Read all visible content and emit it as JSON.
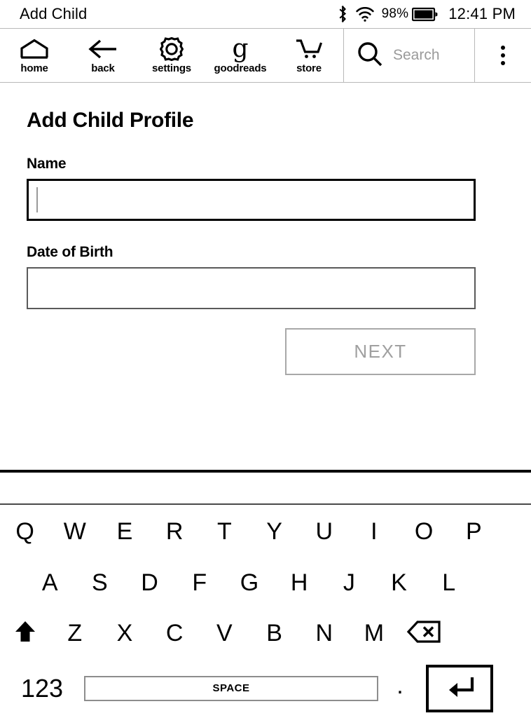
{
  "status_bar": {
    "title": "Add Child",
    "bluetooth_icon": "bluetooth-icon",
    "wifi_icon": "wifi-icon",
    "battery_percent": "98%",
    "battery_icon": "battery-icon",
    "time": "12:41 PM"
  },
  "toolbar": {
    "items": [
      {
        "label": "home",
        "icon": "home-icon"
      },
      {
        "label": "back",
        "icon": "back-arrow-icon"
      },
      {
        "label": "settings",
        "icon": "gear-icon"
      },
      {
        "label": "goodreads",
        "icon": "goodreads-g-icon",
        "glyph": "g"
      },
      {
        "label": "store",
        "icon": "shopping-cart-icon"
      }
    ],
    "search": {
      "icon": "search-icon",
      "placeholder": "Search",
      "value": ""
    },
    "overflow_icon": "overflow-menu-icon"
  },
  "main": {
    "page_title": "Add Child Profile",
    "fields": [
      {
        "label": "Name",
        "value": "",
        "focused": true
      },
      {
        "label": "Date of Birth",
        "value": "",
        "focused": false
      }
    ],
    "next_button": {
      "label": "NEXT",
      "enabled": false
    }
  },
  "keyboard": {
    "row1": [
      "Q",
      "W",
      "E",
      "R",
      "T",
      "Y",
      "U",
      "I",
      "O",
      "P"
    ],
    "row2": [
      "A",
      "S",
      "D",
      "F",
      "G",
      "H",
      "J",
      "K",
      "L"
    ],
    "row3": [
      "Z",
      "X",
      "C",
      "V",
      "B",
      "N",
      "M"
    ],
    "shift_icon": "shift-up-arrow-icon",
    "backspace_icon": "backspace-icon",
    "numbers_key": "123",
    "space_key": "SPACE",
    "period_key": ".",
    "enter_icon": "enter-return-icon"
  },
  "colors": {
    "background": "#ffffff",
    "text": "#000000",
    "muted": "#9a9a9a",
    "border_light": "#b9b9b9",
    "border_focus": "#000000",
    "disabled": "#a0a0a0"
  }
}
